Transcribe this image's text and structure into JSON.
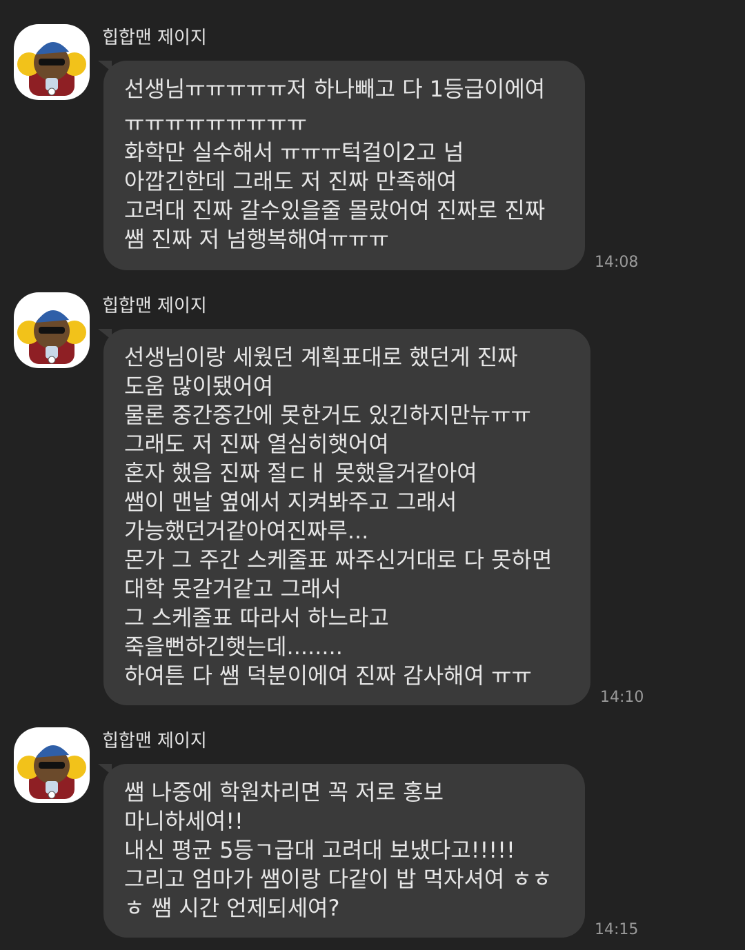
{
  "messages": [
    {
      "sender": "힙합맨 제이지",
      "avatar_icon": "character-avatar-icon",
      "time": "14:08",
      "lines": [
        "선생님ㅠㅠㅠㅠㅠ저 하나빼고 다 1등급이에여",
        "ㅠㅠㅠㅠㅠㅠㅠㅠㅠ",
        "화학만 실수해서 ㅠㅠㅠ턱걸이2고 넘",
        "아깝긴한데 그래도 저 진짜 만족해여",
        "고려대 진짜 갈수있을줄 몰랐어여 진짜로 진짜",
        "쌤 진짜 저 넘행복해여ㅠㅠㅠ"
      ]
    },
    {
      "sender": "힙합맨 제이지",
      "avatar_icon": "character-avatar-icon",
      "time": "14:10",
      "lines": [
        "선생님이랑 세웠던 계획표대로 했던게 진짜",
        "도움 많이됐어여",
        "물론 중간중간에 못한거도 있긴하지만뉴ㅠㅠ",
        "그래도 저 진짜 열심히햇어여",
        "혼자 했음 진짜 절ㄷㅐ 못했을거같아여",
        "쌤이 맨날 옆에서 지켜봐주고 그래서",
        "가능했던거같아여진짜루...",
        "몬가 그 주간 스케줄표 짜주신거대로 다 못하면",
        "대학 못갈거같고 그래서",
        "그 스케줄표 따라서 하느라고",
        "죽을뻔하긴햇는데........",
        "하여튼 다 쌤 덕분이에여 진짜 감사해여 ㅠㅠ"
      ]
    },
    {
      "sender": "힙합맨 제이지",
      "avatar_icon": "character-avatar-icon",
      "time": "14:15",
      "lines": [
        "쌤 나중에 학원차리면 꼭 저로 홍보",
        "마니하세여!!",
        "내신 평균 5등ㄱ급대 고려대 보냈다고!!!!!",
        "그리고 엄마가 쌤이랑 다같이 밥 먹자셔여 ㅎㅎ",
        "ㅎ 쌤 시간 언제되세여?"
      ]
    }
  ]
}
